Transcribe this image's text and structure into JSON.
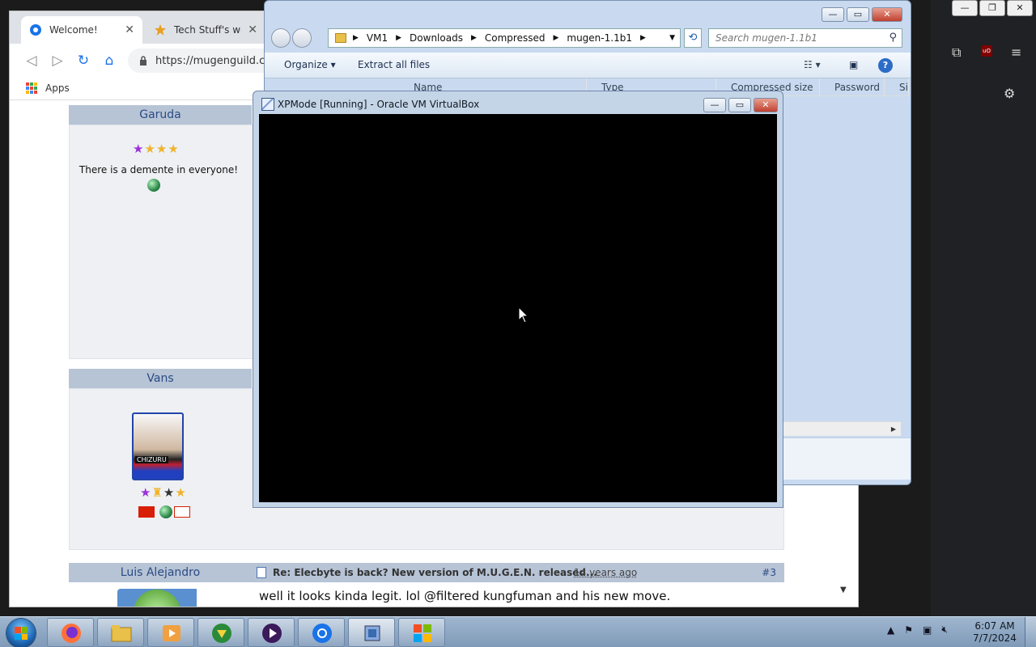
{
  "browser": {
    "tabs": [
      {
        "label": "Welcome!",
        "close": "✕"
      },
      {
        "label": "Tech Stuff's web",
        "close": "✕"
      }
    ],
    "url": "https://mugenguild.co",
    "bookmarks_apps_label": "Apps"
  },
  "forum": {
    "users": [
      {
        "name": "Garuda",
        "signature": "There is a demente in everyone!"
      },
      {
        "name": "Vans",
        "avatar_label": "CHIZURU"
      }
    ],
    "post": {
      "author": "Luis Alejandro",
      "title": "Re: Elecbyte is back? New version of M.U.G.E.N. released...",
      "ago": "14 years ago",
      "number": "#3",
      "body": "well it looks kinda legit. lol @filtered kungfuman and his new move."
    }
  },
  "explorer": {
    "breadcrumbs": [
      "VM1",
      "Downloads",
      "Compressed",
      "mugen-1.1b1"
    ],
    "search_placeholder": "Search mugen-1.1b1",
    "commands": {
      "organize": "Organize",
      "extract": "Extract all files"
    },
    "columns": [
      "Name",
      "Type",
      "Compressed size",
      "Password ...",
      "Si"
    ]
  },
  "vbox": {
    "title": "XPMode [Running] - Oracle VM VirtualBox"
  },
  "taskbar": {
    "clock_time": "6:07 AM",
    "clock_date": "7/7/2024"
  },
  "colors": {
    "forum_header": "#b7c4d6",
    "forum_link": "#2b4b83",
    "vm_screen": "#000000",
    "taskbar": "#8fa8c4"
  }
}
